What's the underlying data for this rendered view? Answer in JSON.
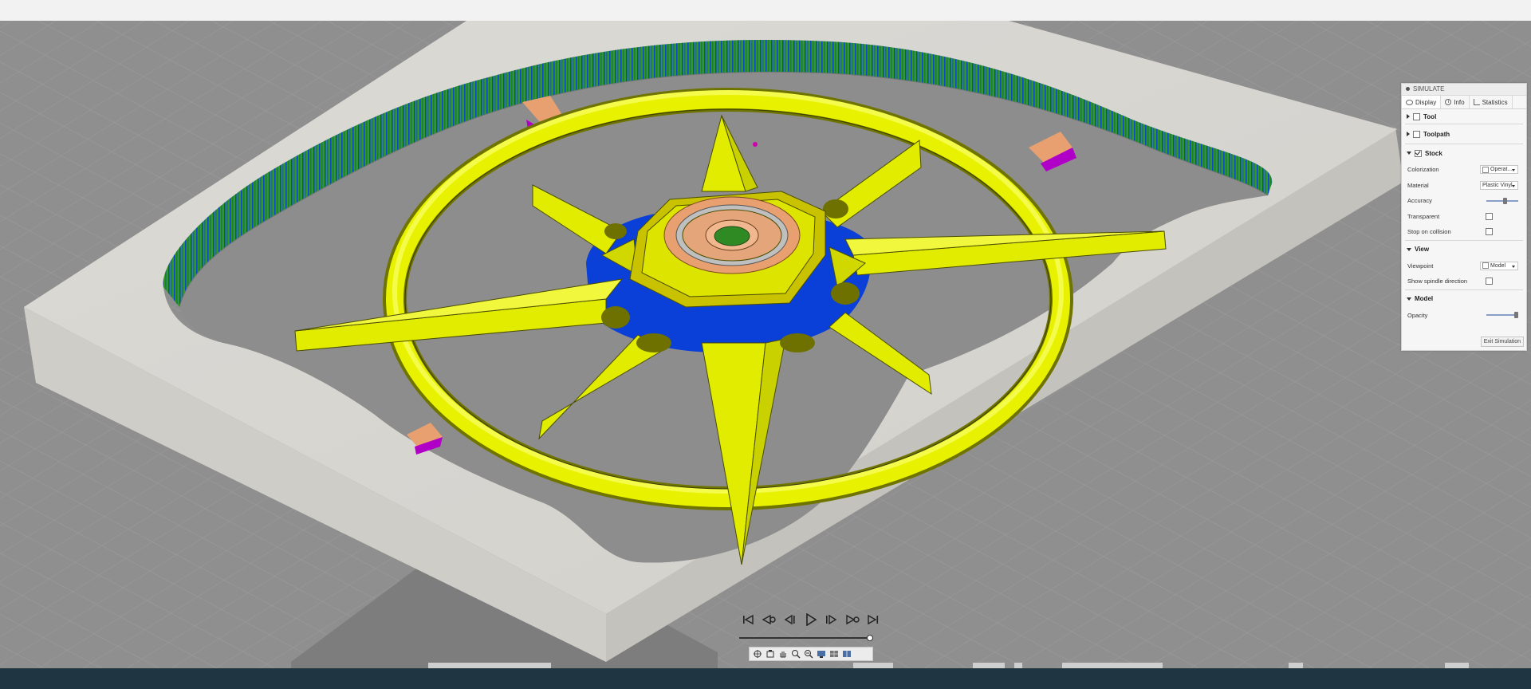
{
  "panel": {
    "title": "SIMULATE",
    "tabs": [
      {
        "label": "Display",
        "icon": "eye-icon"
      },
      {
        "label": "Info",
        "icon": "info-icon"
      },
      {
        "label": "Statistics",
        "icon": "statistics-icon"
      }
    ],
    "sections": {
      "tool": {
        "label": "Tool",
        "expanded": false,
        "checked": false
      },
      "toolpath": {
        "label": "Toolpath",
        "expanded": false,
        "checked": false
      },
      "stock": {
        "label": "Stock",
        "expanded": true,
        "checked": true,
        "colorization_label": "Colorization",
        "colorization_value": "Operat...",
        "material_label": "Material",
        "material_value": "Plastic Vinyl",
        "accuracy_label": "Accuracy",
        "accuracy_level": 0.6,
        "transparent_label": "Transparent",
        "transparent_checked": false,
        "stop_on_collision_label": "Stop on collision",
        "stop_on_collision_checked": false
      },
      "view": {
        "label": "View",
        "expanded": true,
        "viewpoint_label": "Viewpoint",
        "viewpoint_value": "Model",
        "spindle_label": "Show spindle direction",
        "spindle_checked": false
      },
      "model": {
        "label": "Model",
        "expanded": true,
        "opacity_label": "Opacity",
        "opacity_level": 1.0
      }
    },
    "exit_label": "Exit Simulation"
  },
  "playback": {
    "buttons": [
      "go-to-start",
      "previous-operation",
      "step-back",
      "play",
      "step-forward",
      "next-operation",
      "go-to-end"
    ],
    "progress": 1.0
  },
  "nav_toolbar": {
    "icons": [
      "orbit-icon",
      "look-at-icon",
      "pan-icon",
      "zoom-icon",
      "fit-icon",
      "display-settings-icon",
      "grid-icon",
      "viewports-icon"
    ]
  },
  "colors": {
    "stock": "#d9d7d2",
    "model_yellow": "#e8f200",
    "cut_blue": "#0a3fd8",
    "cut_green": "#2a8f1e",
    "copper": "#e8a070",
    "magenta": "#b000c8",
    "ground": "#8e8e8e",
    "status_bar": "#1f3542"
  }
}
